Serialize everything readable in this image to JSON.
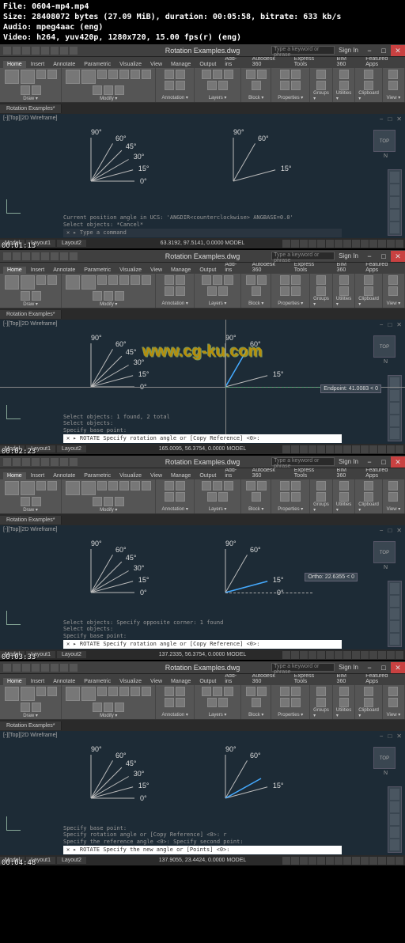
{
  "meta": {
    "file": "File: 0604-mp4.mp4",
    "size": "Size: 28408072 bytes (27.09 MiB), duration: 00:05:58, bitrate: 633 kb/s",
    "audio": "Audio: mpeg4aac (eng)",
    "video": "Video: h264, yuv420p, 1280x720, 15.00 fps(r) (eng)"
  },
  "app": {
    "title": "Rotation Examples.dwg",
    "search_ph": "Type a keyword or phrase",
    "signin": "Sign In",
    "tabs": [
      "Home",
      "Insert",
      "Annotate",
      "Parametric",
      "Visualize",
      "View",
      "Manage",
      "Output",
      "Add-ins",
      "Autodesk 360",
      "Express Tools",
      "BIM 360",
      "Featured Apps"
    ],
    "panels": [
      "Draw",
      "Modify",
      "Annotation",
      "Layers",
      "Block",
      "Properties",
      "Groups",
      "Utilities",
      "Clipboard",
      "View"
    ],
    "filetab": "Rotation Examples*",
    "vp_label": "[-][Top][2D Wireframe]",
    "cube": "TOP",
    "nav_n": "N",
    "model": "Model",
    "layout1": "Layout1",
    "layout2": "Layout2",
    "model_sp": "MODEL"
  },
  "angles": [
    "90°",
    "60°",
    "45°",
    "30°",
    "15°",
    "0°"
  ],
  "angles_sparse": [
    "90°",
    "60°",
    "15°"
  ],
  "watermark": "www.cg-ku.com",
  "shots": [
    {
      "ts": "00:01:13",
      "coords": "63.3192, 97.5141, 0.0000",
      "hist": [
        "Current position angle in UCS: 'ANGDIR<counterclockwise> ANGBASE=0.0'",
        "Select objects: *Cancel*"
      ],
      "cmd": "Type a command",
      "cmd_dark": true,
      "right_sparse": true
    },
    {
      "ts": "00:02:23",
      "coords": "165.0095, 56.3754, 0.0000",
      "hist": [
        "Select objects: 1 found, 2 total",
        "Select objects:",
        "Specify base point:"
      ],
      "cmd": "ROTATE Specify rotation angle or [Copy Reference] <0>:",
      "tooltip": "Endpoint: 41.0083 < 0",
      "crosshair": true,
      "track": true
    },
    {
      "ts": "00:03:33",
      "coords": "137.2335, 56.3754, 0.0000",
      "hist": [
        "Select objects: Specify opposite corner: 1 found",
        "Select objects:",
        "Specify base point:"
      ],
      "cmd": "ROTATE Specify rotation angle or [Copy Reference] <0>:",
      "tooltip": "Ortho: 22.6355 < 0",
      "dashed": true
    },
    {
      "ts": "00:04:48",
      "coords": "137.9055, 23.4424, 0.0000",
      "hist": [
        "Specify base point:",
        "Specify rotation angle or [Copy Reference] <0>: r",
        "Specify the reference angle <0>: Specify second point:"
      ],
      "cmd": "ROTATE Specify the new angle or [Points] <0>:"
    }
  ]
}
